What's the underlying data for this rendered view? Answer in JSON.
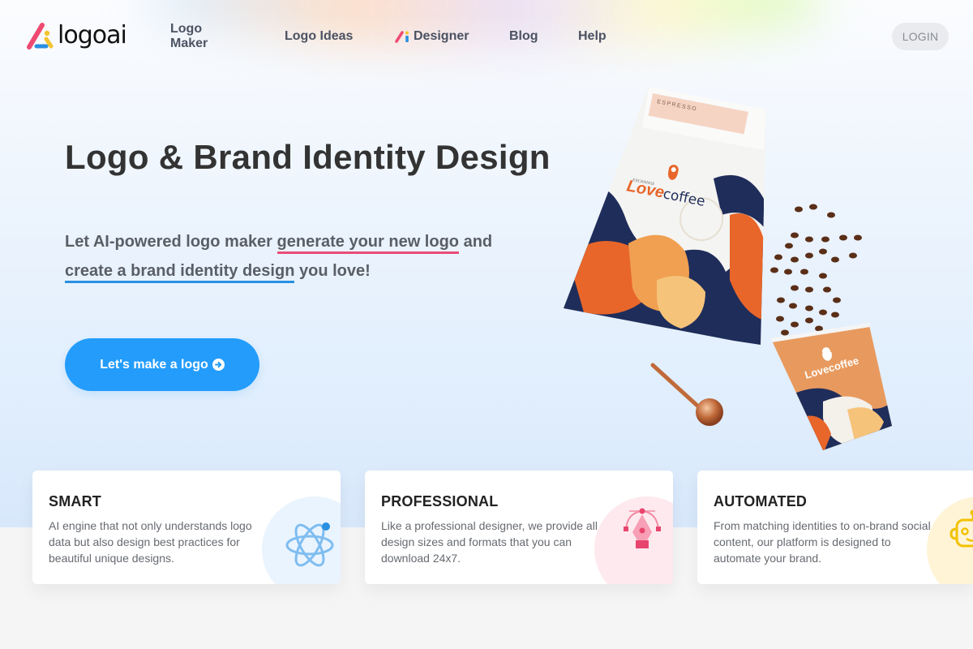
{
  "brand": {
    "name": "logoai",
    "colors": {
      "pink": "#ea4c7a",
      "blue": "#2a8fe0",
      "yellow": "#f4c430",
      "cta": "#239cfb"
    }
  },
  "nav": {
    "items": [
      {
        "label": "Logo Maker"
      },
      {
        "label": "Logo Ideas"
      },
      {
        "label": "Designer",
        "icon": "designer-logo-icon"
      },
      {
        "label": "Blog"
      },
      {
        "label": "Help"
      }
    ],
    "login_label": "LOGIN"
  },
  "hero": {
    "title": "Logo & Brand Identity Design",
    "subtitle": {
      "part1": "Let AI-powered logo maker ",
      "highlight1": "generate your new logo",
      "part2": " and ",
      "highlight2": "create a brand identity design",
      "part3": " you love!"
    },
    "cta_label": "Let's make a logo",
    "cta_icon": "arrow-circle-right-icon"
  },
  "illustration": {
    "bag_label": "ESPRESSO",
    "brand_small": "EXCHANGE",
    "brand_love": "Love",
    "brand_coffee": "coffee",
    "cup_brand": "Lovecoffee"
  },
  "features": [
    {
      "title": "SMART",
      "description": "AI engine that not only understands logo data but also design best practices for beautiful unique designs.",
      "icon": "atom-icon"
    },
    {
      "title": "PROFESSIONAL",
      "description": "Like a professional designer, we provide all design sizes and formats that you can download 24x7.",
      "icon": "pen-tool-icon"
    },
    {
      "title": "AUTOMATED",
      "description": "From matching identities to on-brand social content, our platform is designed to automate your brand.",
      "icon": "robot-icon"
    }
  ]
}
